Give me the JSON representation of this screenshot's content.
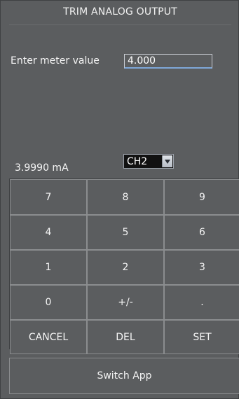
{
  "header": {
    "title": "TRIM ANALOG OUTPUT"
  },
  "meter": {
    "label": "Enter meter value",
    "value": "4.000"
  },
  "readout": {
    "current": "3.9990 mA"
  },
  "channel": {
    "selected": "CH2"
  },
  "keypad": {
    "keys": [
      {
        "label": "7",
        "name": "key-7"
      },
      {
        "label": "8",
        "name": "key-8"
      },
      {
        "label": "9",
        "name": "key-9"
      },
      {
        "label": "4",
        "name": "key-4"
      },
      {
        "label": "5",
        "name": "key-5"
      },
      {
        "label": "6",
        "name": "key-6"
      },
      {
        "label": "1",
        "name": "key-1"
      },
      {
        "label": "2",
        "name": "key-2"
      },
      {
        "label": "3",
        "name": "key-3"
      },
      {
        "label": "0",
        "name": "key-0"
      },
      {
        "label": "+/-",
        "name": "key-plus-minus"
      },
      {
        "label": ".",
        "name": "key-decimal-point"
      },
      {
        "label": "CANCEL",
        "name": "cancel-button"
      },
      {
        "label": "DEL",
        "name": "delete-button"
      },
      {
        "label": "SET",
        "name": "set-button"
      }
    ]
  },
  "footer": {
    "switch_app_label": "Switch App"
  },
  "icons": {
    "dropdown": "chevron-down-icon"
  },
  "colors": {
    "background": "#5b5d5f",
    "input_focus": "#7fa7d9",
    "select_bg": "#111111"
  }
}
